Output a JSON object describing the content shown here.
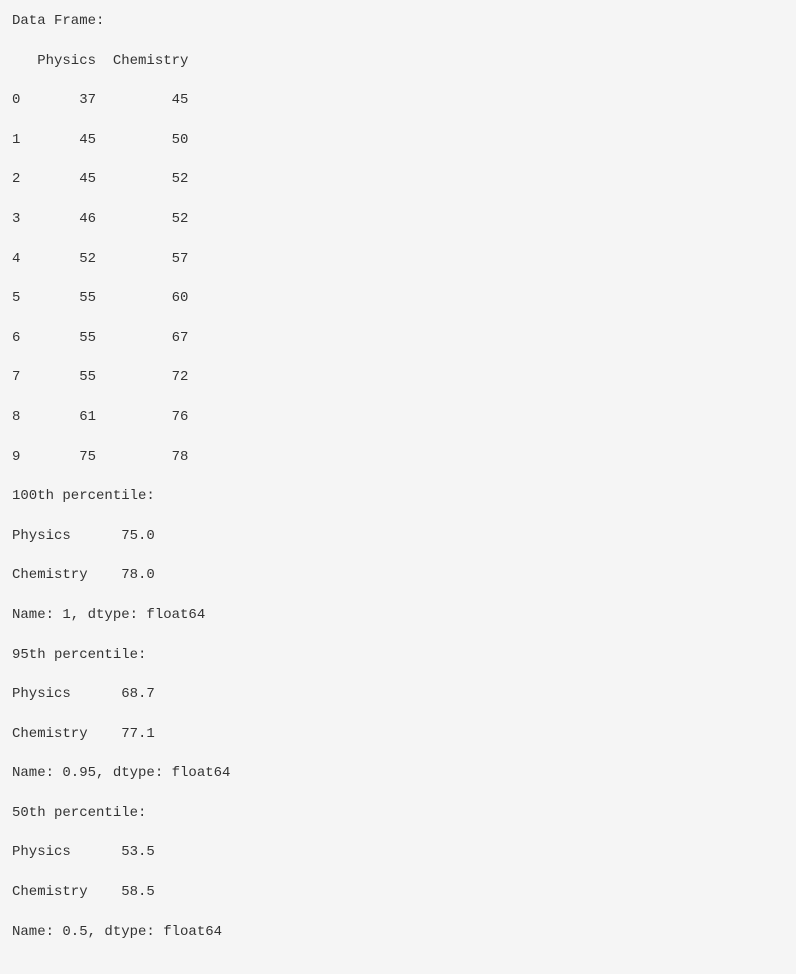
{
  "header": {
    "title": "Data Frame:",
    "columns": "   Physics  Chemistry"
  },
  "rows": [
    "0       37         45",
    "1       45         50",
    "2       45         52",
    "3       46         52",
    "4       52         57",
    "5       55         60",
    "6       55         67",
    "7       55         72",
    "8       61         76",
    "9       75         78"
  ],
  "percentiles": {
    "p100": {
      "label": "100th percentile:",
      "physics": "Physics      75.0",
      "chemistry": "Chemistry    78.0",
      "meta": "Name: 1, dtype: float64"
    },
    "p95": {
      "label": "95th percentile:",
      "physics": "Physics      68.7",
      "chemistry": "Chemistry    77.1",
      "meta": "Name: 0.95, dtype: float64"
    },
    "p50": {
      "label": "50th percentile:",
      "physics": "Physics      53.5",
      "chemistry": "Chemistry    58.5",
      "meta": "Name: 0.5, dtype: float64"
    }
  },
  "chart_data": {
    "type": "table",
    "title": "Data Frame",
    "columns": [
      "Physics",
      "Chemistry"
    ],
    "index": [
      0,
      1,
      2,
      3,
      4,
      5,
      6,
      7,
      8,
      9
    ],
    "data": [
      [
        37,
        45
      ],
      [
        45,
        50
      ],
      [
        45,
        52
      ],
      [
        46,
        52
      ],
      [
        52,
        57
      ],
      [
        55,
        60
      ],
      [
        55,
        67
      ],
      [
        55,
        72
      ],
      [
        61,
        76
      ],
      [
        75,
        78
      ]
    ],
    "percentiles": [
      {
        "name": "100th",
        "quantile": 1.0,
        "Physics": 75.0,
        "Chemistry": 78.0
      },
      {
        "name": "95th",
        "quantile": 0.95,
        "Physics": 68.7,
        "Chemistry": 77.1
      },
      {
        "name": "50th",
        "quantile": 0.5,
        "Physics": 53.5,
        "Chemistry": 58.5
      }
    ]
  }
}
